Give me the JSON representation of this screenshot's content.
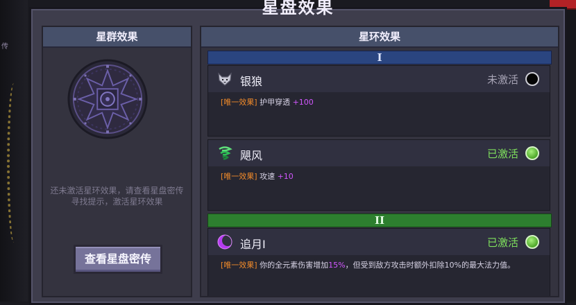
{
  "dialog": {
    "title": "星盘效果"
  },
  "left_panel": {
    "header": "星群效果",
    "hint": "还未激活星环效果，请查看星盘密传寻找提示，激活星环效果",
    "view_button": "查看星盘密传"
  },
  "right_panel": {
    "header": "星环效果",
    "tiers": [
      {
        "label": "I"
      },
      {
        "label": "II"
      }
    ],
    "effects": [
      {
        "name": "银狼",
        "icon": "wolf-icon",
        "status": "未激活",
        "active": false,
        "tag": "[唯一效果]",
        "desc": "护甲穿透",
        "bonus": "+100"
      },
      {
        "name": "飓风",
        "icon": "tornado-icon",
        "status": "已激活",
        "active": true,
        "tag": "[唯一效果]",
        "desc": "攻速",
        "bonus": "+10"
      },
      {
        "name": "追月Ⅰ",
        "icon": "moon-icon",
        "status": "已激活",
        "active": true,
        "tag": "[唯一效果]",
        "desc_pre": "你的全元素伤害增加",
        "desc_pct": "15%",
        "desc_post": "，但受到敌方攻击时额外扣除10%的最大法力值。"
      }
    ]
  },
  "colors": {
    "tier1": "#2a4580",
    "tier2": "#2d7f2f",
    "tag": "#f08a2a",
    "bonus": "#d257ff",
    "active": "#7fe15d"
  }
}
